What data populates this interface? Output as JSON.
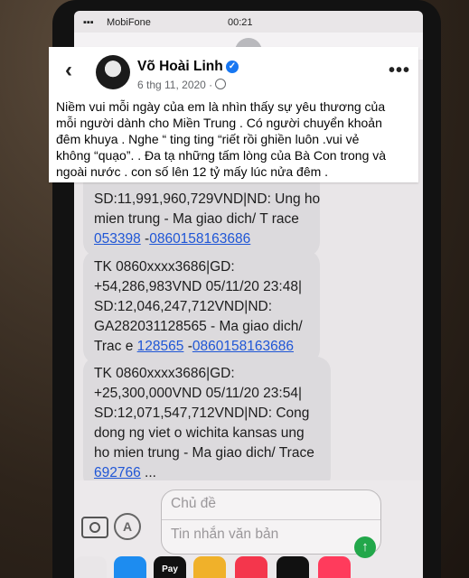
{
  "status_bar": {
    "carrier": "MobiFone",
    "time": "00:21"
  },
  "post": {
    "author": "Võ Hoài Linh",
    "date": "6 thg 11, 2020 ·",
    "text_lines": [
      "Niềm vui mỗi ngày của em là nhìn thấy sự yêu thương của",
      "mỗi người dành cho Miền Trung . Có người chuyển khoản",
      "đêm khuya .  Nghe “ ting ting “riết rồi ghiền luôn .vui vẻ",
      "không “quạo”. . Đa tạ những tấm lòng của Bà Con trong và",
      "ngoài nước . con số lên 12 tỷ mấy lúc  nửa đêm ."
    ]
  },
  "messages": [
    {
      "lines": [
        "SD:11,991,960,729VND|ND: Ung ho",
        "mien trung - Ma giao dich/ T race"
      ],
      "link_line": {
        "a": "053398",
        "sep": " -",
        "b": "0860158163686"
      }
    },
    {
      "lines": [
        "TK 0860xxxx3686|GD:",
        "+54,286,983VND 05/11/20 23:48|",
        "SD:12,046,247,712VND|ND:",
        "GA282031128565 - Ma giao dich/"
      ],
      "link_line": {
        "prefix": "Trac e ",
        "a": "128565",
        "sep": " -",
        "b": "0860158163686"
      }
    },
    {
      "lines": [
        "TK 0860xxxx3686|GD:",
        "+25,300,000VND 05/11/20 23:54|",
        "SD:12,071,547,712VND|ND: Cong",
        "dong ng viet o wichita kansas ung",
        "ho mien trung - Ma giao dich/ Trace"
      ],
      "link_line": {
        "a": "692766",
        "sep": " ..."
      }
    }
  ],
  "compose": {
    "subject_placeholder": "Chủ đề",
    "body_placeholder": "Tin nhắn văn bản"
  },
  "apps": [
    "Pay"
  ]
}
